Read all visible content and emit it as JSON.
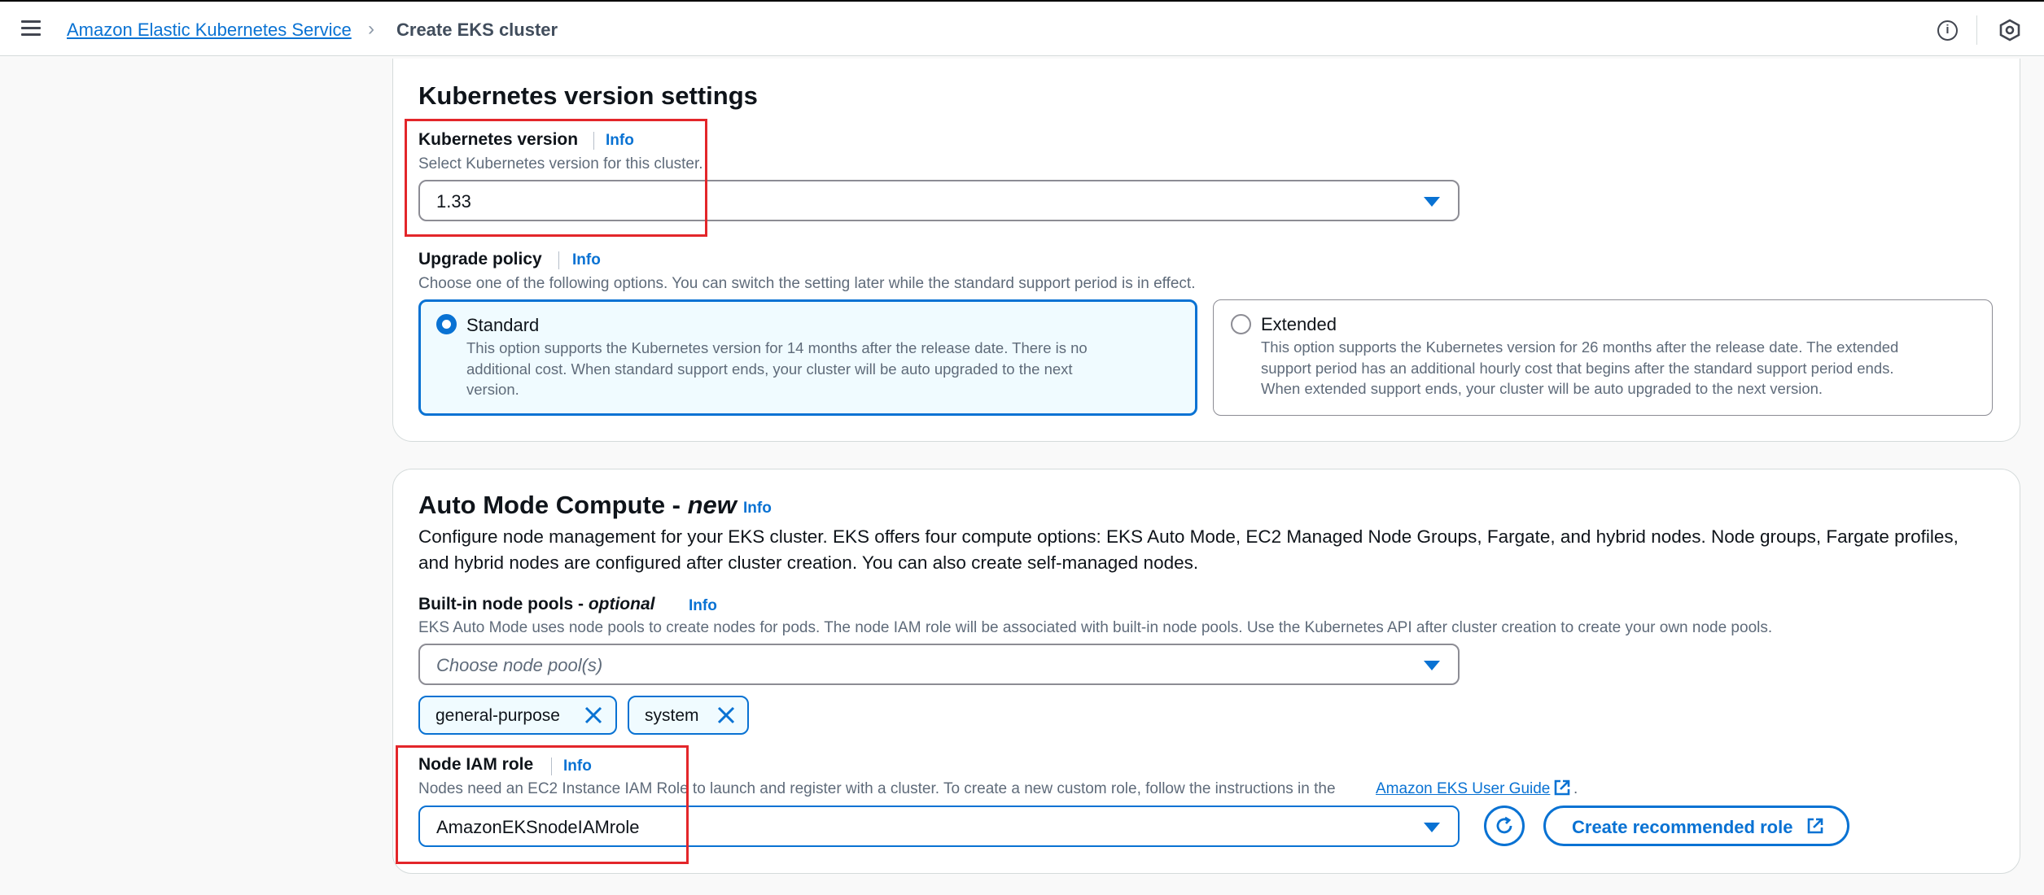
{
  "breadcrumb": {
    "service": "Amazon Elastic Kubernetes Service",
    "separator": ">",
    "current": "Create EKS cluster"
  },
  "kubernetes_version_settings": {
    "title": "Kubernetes version settings",
    "version_label": "Kubernetes version",
    "info": "Info",
    "version_desc": "Select Kubernetes version for this cluster.",
    "version_value": "1.33",
    "upgrade_policy_label": "Upgrade policy",
    "upgrade_policy_desc": "Choose one of the following options. You can switch the setting later while the standard support period is in effect.",
    "options": [
      {
        "title": "Standard",
        "selected": true,
        "desc_lines": [
          "This option supports the Kubernetes version for 14 months after the release date. There is no",
          "additional cost. When standard support ends, your cluster will be auto upgraded to the next",
          "version."
        ]
      },
      {
        "title": "Extended",
        "selected": false,
        "desc_lines": [
          "This option supports the Kubernetes version for 26 months after the release date. The extended",
          "support period has an additional hourly cost that begins after the standard support period ends.",
          "When extended support ends, your cluster will be auto upgraded to the next version."
        ]
      }
    ]
  },
  "auto_mode": {
    "title_main": "Auto Mode Compute - ",
    "title_new": "new",
    "info": "Info",
    "desc_lines": [
      "Configure node management for your EKS cluster. EKS offers four compute options: EKS Auto Mode, EC2 Managed Node Groups, Fargate, and hybrid nodes. Node groups, Fargate profiles,",
      "and hybrid nodes are configured after cluster creation. You can also create self-managed nodes."
    ],
    "node_pools_label": "Built-in node pools - ",
    "node_pools_optional": "optional",
    "node_pools_desc": "EKS Auto Mode uses node pools to create nodes for pods. The node IAM role will be associated with built-in node pools. Use the Kubernetes API after cluster creation to create your own node pools.",
    "node_pools_placeholder": "Choose node pool(s)",
    "tokens": [
      "general-purpose",
      "system"
    ],
    "iam_role_label": "Node IAM role",
    "iam_role_desc": "Nodes need an EC2 Instance IAM Role to launch and register with a cluster. To create a new custom role, follow the instructions in the",
    "iam_guide_link": "Amazon EKS User Guide",
    "iam_role_desc_end": ".",
    "iam_role_value": "AmazonEKSnodeIAMrole",
    "create_role_button": "Create recommended role"
  },
  "colors": {
    "accent": "#0972d3",
    "highlight_box": "#e3262a"
  }
}
